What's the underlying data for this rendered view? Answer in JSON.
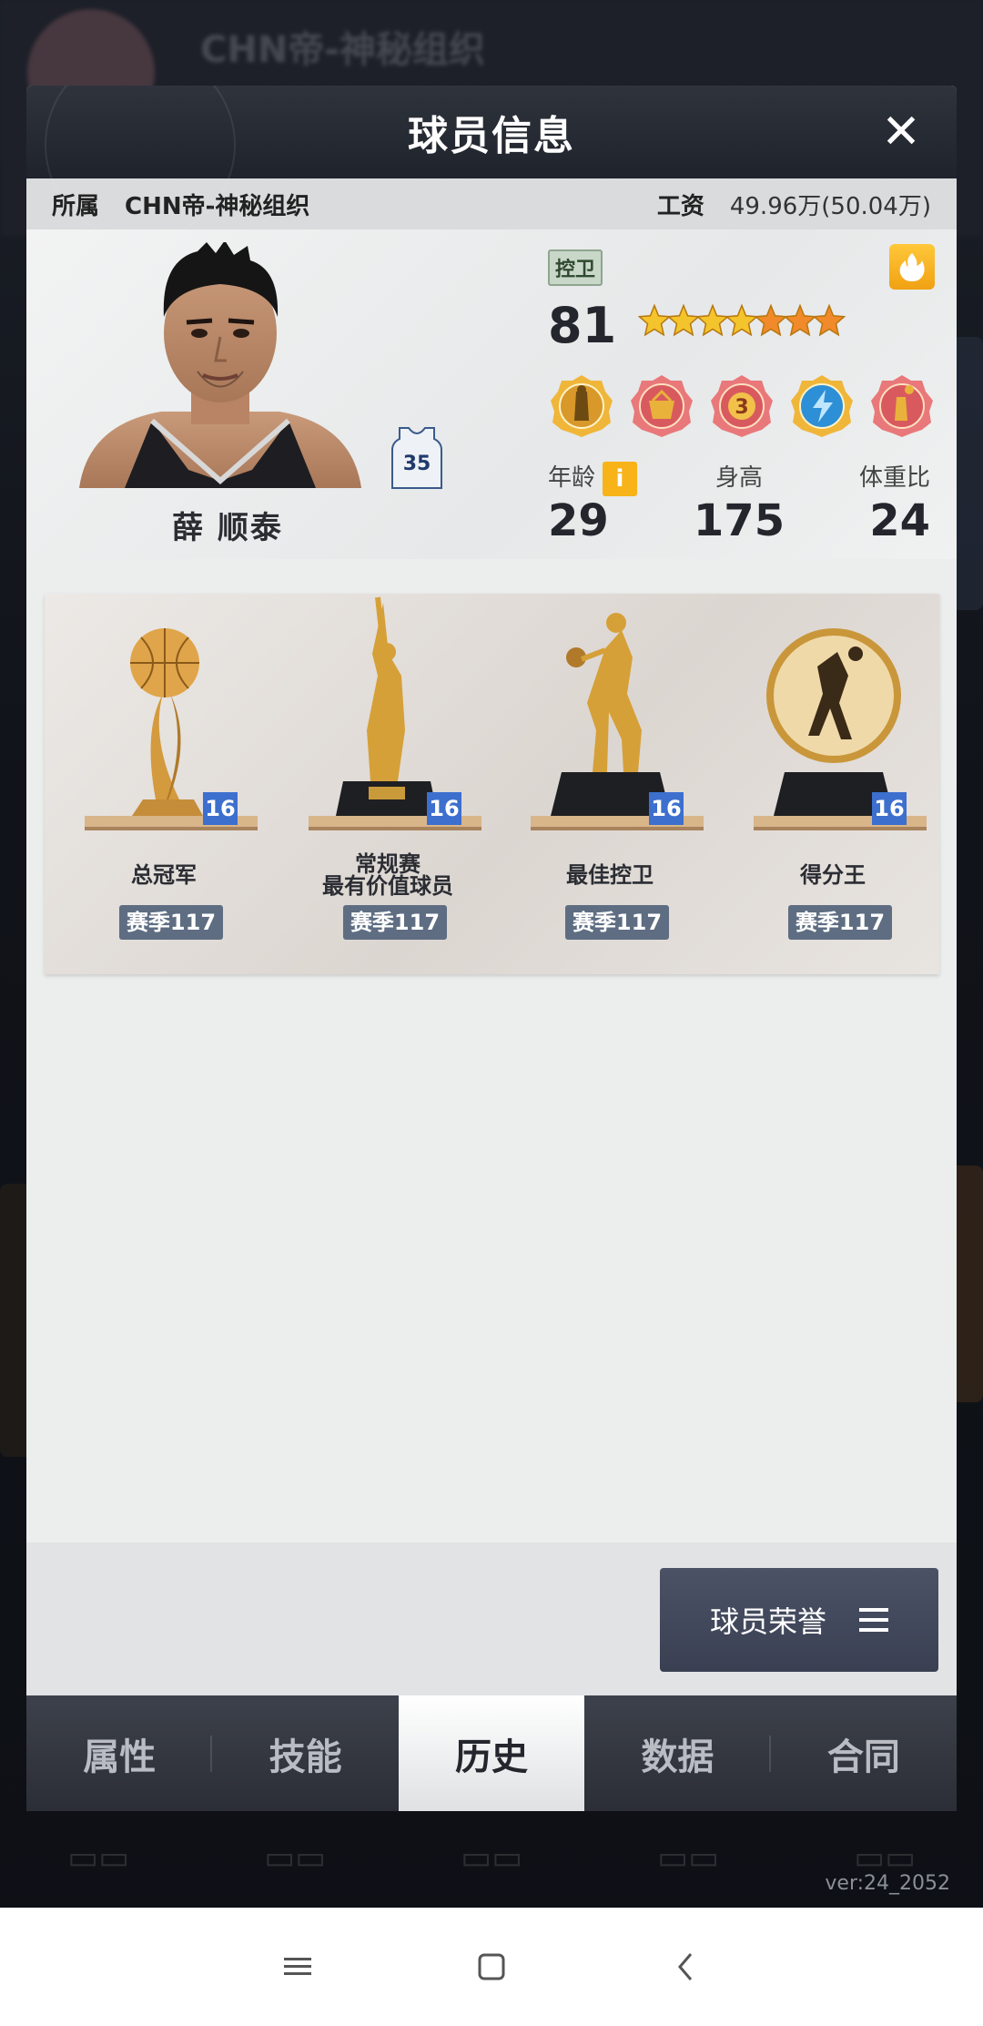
{
  "modal": {
    "title": "球员信息",
    "close_label": "✕"
  },
  "info_strip": {
    "team_label": "所属",
    "team_name": "CHN帝-神秘组织",
    "salary_label": "工资",
    "salary_value": "49.96万(50.04万)"
  },
  "player": {
    "name": "薛 顺泰",
    "jersey_number": "35",
    "position": "控卫",
    "rating": "81",
    "stars_total": 7,
    "stats_labels": {
      "age": "年龄",
      "height": "身高",
      "weight_ratio": "体重比"
    },
    "stats": {
      "age": "29",
      "height": "175",
      "weight_ratio": "24"
    },
    "info_icon": "i"
  },
  "trophies": [
    {
      "name": "总冠军",
      "count": "16",
      "season": "赛季117",
      "icon": "basketball-trophy-icon"
    },
    {
      "name": "常规赛\n最有价值球员",
      "name_line1": "常规赛",
      "name_line2": "最有价值球员",
      "count": "16",
      "season": "赛季117",
      "icon": "mvp-trophy-icon"
    },
    {
      "name": "最佳控卫",
      "count": "16",
      "season": "赛季117",
      "icon": "dribble-trophy-icon"
    },
    {
      "name": "得分王",
      "count": "16",
      "season": "赛季117",
      "icon": "scoring-medal-icon"
    }
  ],
  "honor_button": {
    "label": "球员荣誉",
    "icon": "menu-icon"
  },
  "tabs": [
    {
      "label": "属性",
      "active": false
    },
    {
      "label": "技能",
      "active": false
    },
    {
      "label": "历史",
      "active": true
    },
    {
      "label": "数据",
      "active": false
    },
    {
      "label": "合同",
      "active": false
    }
  ],
  "background": {
    "title": "CHN帝-神秘组织"
  },
  "version": "ver:24_2052",
  "colors": {
    "accent_blue": "#3c6fce",
    "season_tag": "#5e6d82",
    "gold": "#f7b317"
  }
}
